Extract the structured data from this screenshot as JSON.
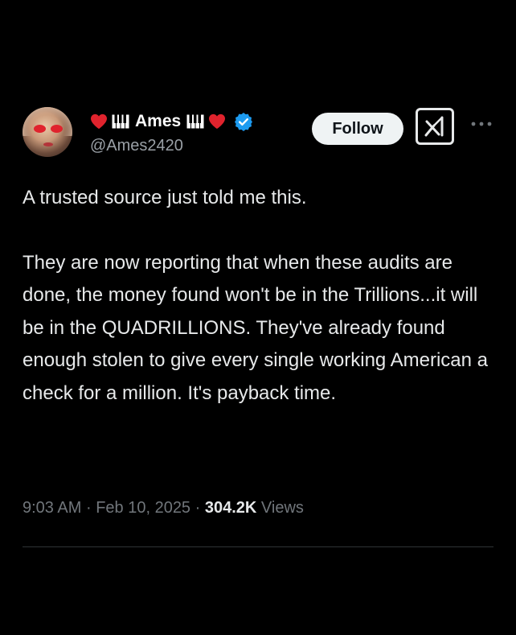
{
  "author": {
    "display_name": "Ames",
    "handle": "@Ames2420",
    "verified": true,
    "name_decorations": [
      "red-heart-icon",
      "piano-keys-icon"
    ]
  },
  "actions": {
    "follow_label": "Follow",
    "grok_icon": "grok-icon",
    "more_icon": "more-options-icon"
  },
  "tweet": {
    "paragraphs": [
      "A trusted source just told me this.",
      "They are now reporting that when these audits are done, the money found won't be in the Trillions...it will be in the QUADRILLIONS. They've already found enough stolen to give every single working American a check for a million. It's payback time."
    ]
  },
  "meta": {
    "time": "9:03 AM",
    "separator": "·",
    "date": "Feb 10, 2025",
    "views_count": "304.2K",
    "views_label": "Views"
  },
  "colors": {
    "background": "#000000",
    "text": "#e7e9ea",
    "secondary_text": "#71767b",
    "verified_blue": "#1d9bf0",
    "heart_red": "#e0232d"
  }
}
